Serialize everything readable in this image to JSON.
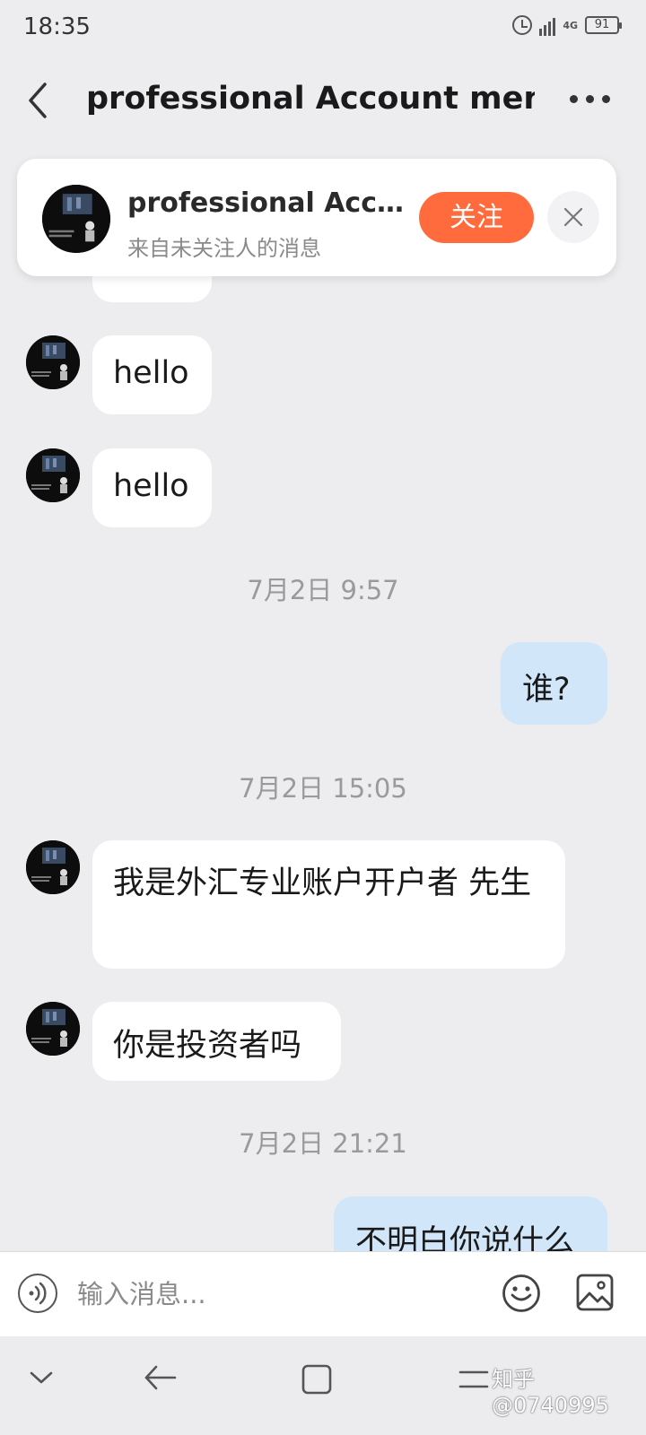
{
  "status_bar": {
    "time": "18:35",
    "network": "4G",
    "battery": "91"
  },
  "header": {
    "title": "professional Account mengar"
  },
  "follow_card": {
    "name": "professional Account management",
    "subtitle": "来自未关注人的消息",
    "follow_label": "关注"
  },
  "messages": [
    {
      "type": "bubble",
      "direction": "in",
      "text": "hello"
    },
    {
      "type": "bubble",
      "direction": "in",
      "text": "hello"
    },
    {
      "type": "timestamp",
      "text": "7月2日 9:57"
    },
    {
      "type": "bubble",
      "direction": "out",
      "text": "谁?"
    },
    {
      "type": "timestamp",
      "text": "7月2日 15:05"
    },
    {
      "type": "bubble",
      "direction": "in",
      "text": "我是外汇专业账户开户者 先生"
    },
    {
      "type": "bubble",
      "direction": "in",
      "text": "你是投资者吗"
    },
    {
      "type": "timestamp",
      "text": "7月2日 21:21"
    },
    {
      "type": "bubble",
      "direction": "out",
      "text": "不明白你说什么"
    }
  ],
  "input": {
    "placeholder": "输入消息..."
  },
  "watermark": "知乎 @0740995",
  "colors": {
    "follow_button": "#ff6b3d",
    "outgoing_bubble": "#d2e6fa",
    "background": "#ededf0"
  }
}
